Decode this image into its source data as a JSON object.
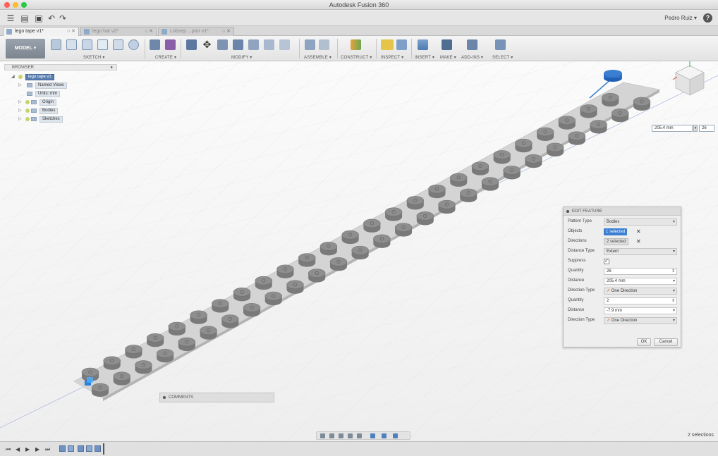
{
  "window": {
    "title": "Autodesk Fusion 360"
  },
  "quickbar": {
    "user": "Pedro Ruiz ▾",
    "help_icon": "?"
  },
  "tabs": [
    {
      "label": "lego tape v1*",
      "active": true
    },
    {
      "label": "lego hat v2*",
      "active": false
    },
    {
      "label": "Lobsep ...ptor v1*",
      "active": false
    }
  ],
  "toolbar": {
    "model_label": "MODEL ▾",
    "groups": [
      "SKETCH ▾",
      "CREATE ▾",
      "MODIFY ▾",
      "ASSEMBLE ▾",
      "CONSTRUCT ▾",
      "INSPECT ▾",
      "INSERT ▾",
      "MAKE ▾",
      "ADD-INS ▾",
      "SELECT ▾"
    ]
  },
  "browser": {
    "title": "BROWSER",
    "root": "lego tape v1",
    "items": [
      "Named Views",
      "Units: mm",
      "Origin",
      "Bodies",
      "Sketches"
    ]
  },
  "canvas_inputs": {
    "distance": "205.4 mm",
    "quantity": "26"
  },
  "dialog": {
    "title": "EDIT FEATURE",
    "rows": [
      {
        "label": "Pattern Type",
        "value": "Bodies"
      },
      {
        "label": "Objects",
        "value": "1 selected"
      },
      {
        "label": "Directions",
        "value": "2 selected"
      },
      {
        "label": "Distance Type",
        "value": "Extent"
      },
      {
        "label": "Suppress",
        "value": ""
      },
      {
        "label": "Quantity",
        "value": "26"
      },
      {
        "label": "Distance",
        "value": "205.4 mm"
      },
      {
        "label": "Direction Type",
        "value": "One Direction"
      },
      {
        "label": "Quantity",
        "value": "2"
      },
      {
        "label": "Distance",
        "value": "-7.9 mm"
      },
      {
        "label": "Direction Type",
        "value": "One Direction"
      }
    ],
    "ok_label": "OK",
    "cancel_label": "Cancel"
  },
  "comments": {
    "label": "COMMENTS"
  },
  "status": {
    "selections": "2 selections"
  },
  "timeline": {
    "controls": [
      "⏮",
      "◀",
      "▶",
      "▶",
      "⏭"
    ]
  },
  "colors": {
    "stud_fill": "#8e8e8e",
    "plate_fill": "#d4d4d4",
    "accent_blue": "#3b7fd1",
    "pattern_blue": "#1f5fb4"
  },
  "pattern": {
    "studs_per_row": 26,
    "rows": 2
  }
}
